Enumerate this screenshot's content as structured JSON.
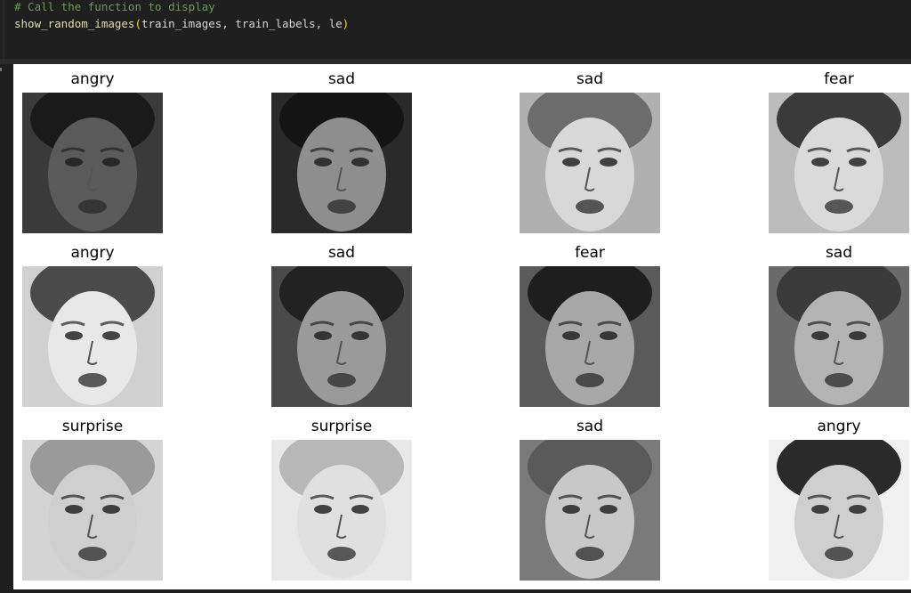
{
  "code_cell": {
    "comment": "# Call the function to display",
    "call": {
      "func": "show_random_images",
      "open": "(",
      "args": "train_images, train_labels, le",
      "close": ")"
    }
  },
  "output": {
    "panels": [
      {
        "label": "angry",
        "shade": "#3a3a3a",
        "skin": "#5a5a5a",
        "hair": "#1a1a1a",
        "icon": "face-image"
      },
      {
        "label": "sad",
        "shade": "#2a2a2a",
        "skin": "#8e8e8e",
        "hair": "#141414",
        "icon": "face-image"
      },
      {
        "label": "sad",
        "shade": "#b0b0b0",
        "skin": "#d8d8d8",
        "hair": "#6c6c6c",
        "icon": "face-image"
      },
      {
        "label": "fear",
        "shade": "#bcbcbc",
        "skin": "#dadada",
        "hair": "#3a3a3a",
        "icon": "face-image"
      },
      {
        "label": "angry",
        "shade": "#d0d0d0",
        "skin": "#e8e8e8",
        "hair": "#4a4a4a",
        "icon": "face-image"
      },
      {
        "label": "sad",
        "shade": "#4a4a4a",
        "skin": "#9a9a9a",
        "hair": "#222222",
        "icon": "face-image"
      },
      {
        "label": "fear",
        "shade": "#5a5a5a",
        "skin": "#a8a8a8",
        "hair": "#1e1e1e",
        "icon": "face-image"
      },
      {
        "label": "sad",
        "shade": "#6a6a6a",
        "skin": "#b4b4b4",
        "hair": "#3a3a3a",
        "icon": "face-image"
      },
      {
        "label": "surprise",
        "shade": "#d4d4d4",
        "skin": "#cfcfcf",
        "hair": "#9a9a9a",
        "icon": "face-image"
      },
      {
        "label": "surprise",
        "shade": "#e8e8e8",
        "skin": "#e0e0e0",
        "hair": "#b8b8b8",
        "icon": "face-image"
      },
      {
        "label": "sad",
        "shade": "#7a7a7a",
        "skin": "#c8c8c8",
        "hair": "#5a5a5a",
        "icon": "face-image"
      },
      {
        "label": "angry",
        "shade": "#f0f0f0",
        "skin": "#cfcfcf",
        "hair": "#2a2a2a",
        "icon": "face-image"
      }
    ]
  }
}
